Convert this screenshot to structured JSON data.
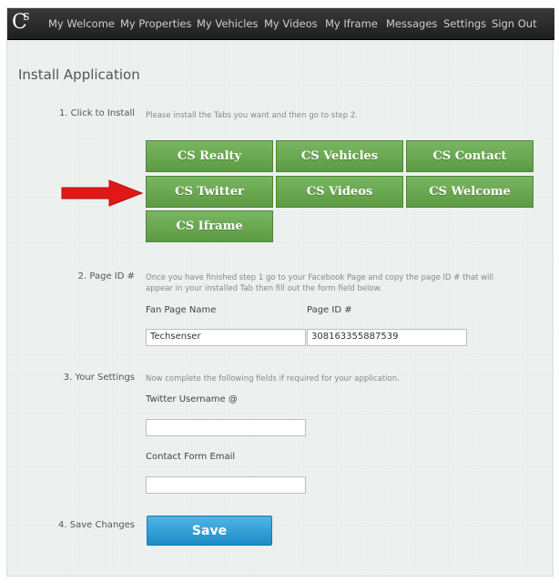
{
  "nav": {
    "logo_c": "C",
    "logo_s": "S",
    "items": [
      "My Welcome",
      "My Properties",
      "My Vehicles",
      "My Videos",
      "My Iframe",
      "Messages",
      "Settings",
      "Sign Out"
    ]
  },
  "page_title": "Install Application",
  "step1": {
    "label": "1. Click to Install",
    "hint": "Please install the Tabs you want and then go to step 2.",
    "tabs": [
      "CS Realty",
      "CS Vehicles",
      "CS Contact",
      "CS Twitter",
      "CS Videos",
      "CS Welcome",
      "CS Iframe"
    ]
  },
  "step2": {
    "label": "2. Page ID #",
    "hint_line1": "Once you have finished step 1 go to your Facebook Page and copy the page ID # that will",
    "hint_line2": "appear in your installed Tab then fill out the form field below.",
    "fan_page_label": "Fan Page Name",
    "fan_page_value": "Techsenser",
    "page_id_label": "Page ID #",
    "page_id_value": "308163355887539"
  },
  "step3": {
    "label": "3. Your Settings",
    "hint": "Now complete the following fields if required for your application.",
    "twitter_label": "Twitter Username @",
    "twitter_value": "",
    "email_label": "Contact Form Email",
    "email_value": ""
  },
  "step4": {
    "label": "4. Save Changes",
    "save_label": "Save"
  },
  "colors": {
    "tab_green": "#6aa851",
    "save_blue": "#2a9ad4",
    "arrow_red": "#e01818"
  }
}
